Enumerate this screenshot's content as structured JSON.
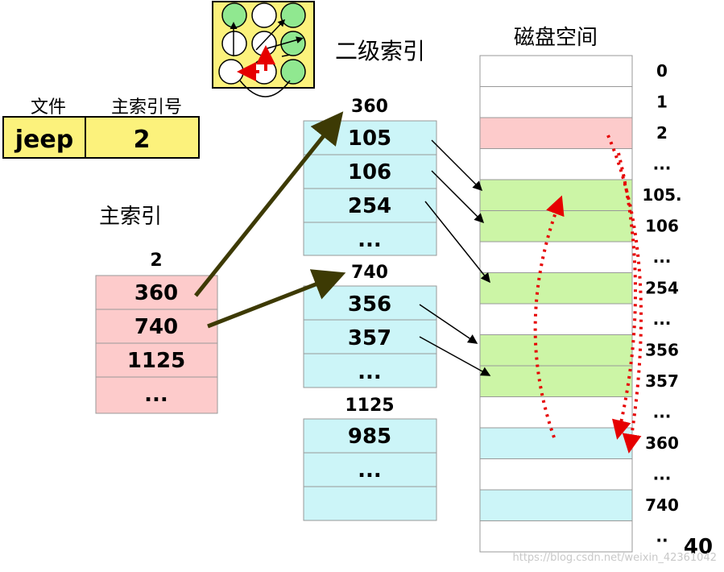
{
  "icon": {
    "name": "graph-traversal-icon"
  },
  "file_table": {
    "headers": [
      "文件",
      "主索引号"
    ],
    "row": [
      "jeep",
      "2"
    ]
  },
  "main_index": {
    "title": "主索引",
    "block_no": "2",
    "entries": [
      "360",
      "740",
      "1125",
      "..."
    ]
  },
  "secondary_index": {
    "title": "二级索引",
    "blocks": [
      {
        "block_no": "360",
        "entries": [
          "105",
          "106",
          "254",
          "..."
        ]
      },
      {
        "block_no": "740",
        "entries": [
          "356",
          "357",
          "..."
        ]
      },
      {
        "block_no": "1125",
        "entries": [
          "985",
          "...",
          ""
        ]
      }
    ]
  },
  "disk": {
    "title": "磁盘空间",
    "labels": [
      "0",
      "1",
      "2",
      "...",
      "105.",
      "106",
      "...",
      "254",
      "...",
      "356",
      "357",
      "...",
      "360",
      "...",
      "740",
      ".."
    ],
    "page_number": "40",
    "watermark": "https://blog.csdn.net/weixin_42361042"
  },
  "colors": {
    "pink": "#fdcbcb",
    "cyan": "#ccf5f8",
    "green": "#ccf5a6",
    "yellow": "#fcf27c",
    "arrow_dark": "#3d3a04",
    "dotted_red": "#e60000"
  }
}
